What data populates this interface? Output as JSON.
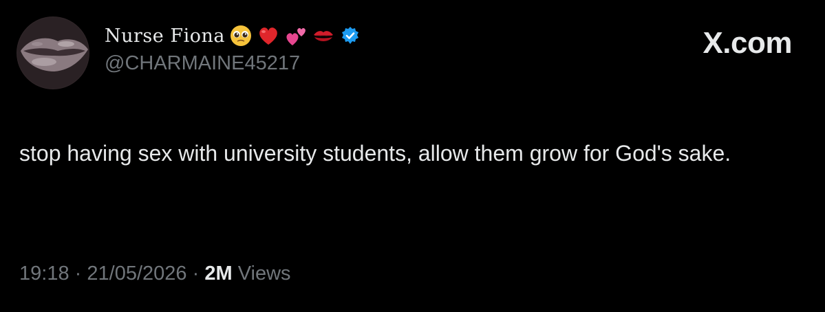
{
  "tweet": {
    "author": {
      "display_name": "Nurse Fiona",
      "handle": "@CHARMAINE45217",
      "avatar": "avatar-lips-image",
      "emojis": [
        "pleading-face-icon",
        "red-heart-icon",
        "two-hearts-icon",
        "kiss-mark-icon"
      ],
      "verified_icon": "verified-badge-icon"
    },
    "brand": "X.com",
    "text": "stop having sex with university students, allow them grow for God's sake.",
    "meta": {
      "time": "19:18",
      "separator": "·",
      "date": "21/05/2026",
      "views_count": "2M",
      "views_label": "Views"
    }
  },
  "colors": {
    "background": "#000000",
    "primary_text": "#e7e9ea",
    "secondary_text": "#71767b",
    "verified_blue": "#1d9bf0"
  }
}
